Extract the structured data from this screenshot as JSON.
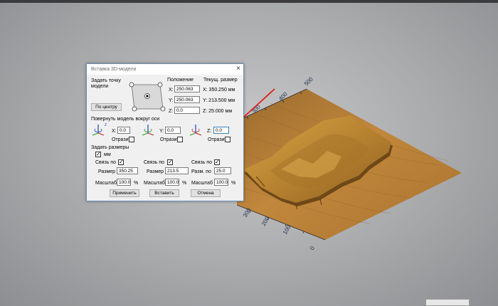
{
  "viewport": {
    "ruler_labels": [
      "500",
      "400",
      "300",
      "200",
      "300",
      "200",
      "100",
      "0"
    ]
  },
  "dialog": {
    "title": "Вставка 3D-модели",
    "close": "×",
    "anchor_label": "Задать точку\nмодели",
    "center_button": "По центру",
    "position_label": "Положение",
    "x_label": "X:",
    "y_label": "Y:",
    "z_label": "Z:",
    "pos_x": "250.063",
    "pos_y": "250.063",
    "pos_z": "0.0",
    "current_size_label": "Текущ. размер",
    "size_x": "X: 350.250 мм",
    "size_y": "Y: 213.500 мм",
    "size_z": "Z: 25.000 мм",
    "rotate_label": "Повернуть модель вокруг оси",
    "rot_x_label": "X:",
    "rot_y_label": "Y:",
    "rot_z_label": "Z:",
    "rot_x": "0.0",
    "rot_y": "0.0",
    "rot_z": "0.0",
    "mirror_label": "Отразит",
    "set_sizes_label": "Задать размеры",
    "mm_label": "мм",
    "link_label": "Связь по",
    "size_label": "Размер",
    "size_label_short": "Разм. по",
    "scale_label": "Масштаб",
    "width_value": "350.25",
    "height_value": "213.5",
    "depth_value": "25.0",
    "scale_x": "100.0",
    "scale_y": "100.0",
    "scale_z": "100.0",
    "percent": "%",
    "apply_button": "Применить",
    "insert_button": "Вставить",
    "cancel_button": "Отмена"
  },
  "colors": {
    "dialog_border": "#6e8fb3",
    "arrow": "#e02020",
    "wood": "#b07a34"
  }
}
